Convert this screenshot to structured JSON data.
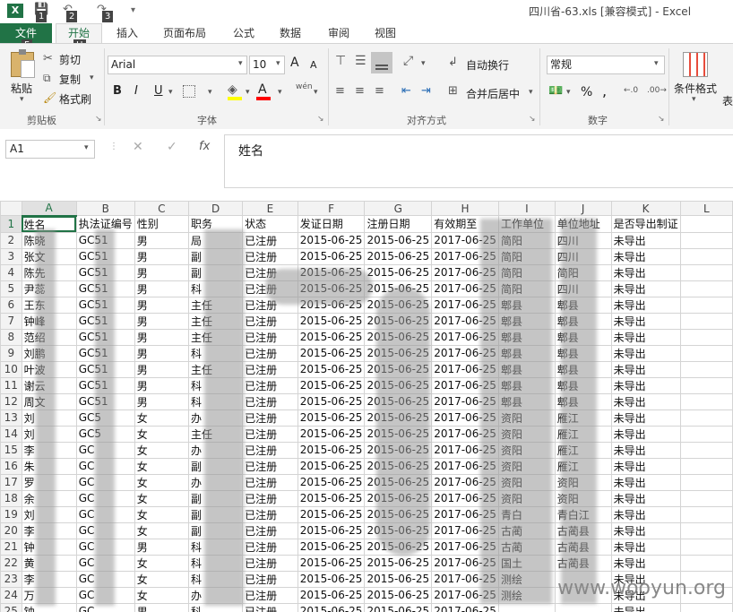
{
  "window": {
    "title": "四川省-63.xls  [兼容模式] - Excel",
    "keytips": [
      "1",
      "2",
      "3",
      "F",
      "H"
    ]
  },
  "tabs": {
    "file": "文件",
    "home": "开始",
    "insert": "插入",
    "layout": "页面布局",
    "formulas": "公式",
    "data": "数据",
    "review": "审阅",
    "view": "视图"
  },
  "ribbon": {
    "clipboard": {
      "paste": "粘贴",
      "cut": "剪切",
      "copy": "复制",
      "format_painter": "格式刷",
      "label": "剪贴板"
    },
    "font": {
      "name": "Arial",
      "size": "10",
      "bold": "B",
      "italic": "I",
      "underline": "U",
      "label": "字体",
      "grow": "A",
      "shrink": "A",
      "wen": "wén"
    },
    "alignment": {
      "wrap": "自动换行",
      "merge": "合并后居中",
      "label": "对齐方式"
    },
    "number": {
      "format": "常规",
      "percent": "%",
      "comma": ",",
      "label": "数字"
    },
    "styles": {
      "conditional": "条件格式",
      "table": "表"
    }
  },
  "formula_bar": {
    "name_box": "A1",
    "fx": "fx",
    "content": "姓名"
  },
  "sheet": {
    "columns": [
      "A",
      "B",
      "C",
      "D",
      "E",
      "F",
      "G",
      "H",
      "I",
      "J",
      "K",
      "L"
    ],
    "rows": [
      [
        "姓名",
        "执法证编号",
        "性别",
        "职务",
        "状态",
        "发证日期",
        "注册日期",
        "有效期至",
        "工作单位",
        "单位地址",
        "是否导出制证",
        ""
      ],
      [
        "陈晓",
        "GC51",
        "男",
        "局",
        "已注册",
        "2015-06-25",
        "2015-06-25",
        "2017-06-25",
        "简阳",
        "四川",
        "未导出",
        ""
      ],
      [
        "张文",
        "GC51",
        "男",
        "副",
        "已注册",
        "2015-06-25",
        "2015-06-25",
        "2017-06-25",
        "简阳",
        "四川",
        "未导出",
        ""
      ],
      [
        "陈先",
        "GC51",
        "男",
        "副",
        "已注册",
        "2015-06-25",
        "2015-06-25",
        "2017-06-25",
        "简阳",
        "简阳",
        "未导出",
        ""
      ],
      [
        "尹蕊",
        "GC51",
        "男",
        "科",
        "已注册",
        "2015-06-25",
        "2015-06-25",
        "2017-06-25",
        "简阳",
        "四川",
        "未导出",
        ""
      ],
      [
        "王东",
        "GC51",
        "男",
        "主任",
        "已注册",
        "2015-06-25",
        "2015-06-25",
        "2017-06-25",
        "郫县",
        "郫县",
        "未导出",
        ""
      ],
      [
        "钟峰",
        "GC51",
        "男",
        "主任",
        "已注册",
        "2015-06-25",
        "2015-06-25",
        "2017-06-25",
        "郫县",
        "郫县",
        "未导出",
        ""
      ],
      [
        "范绍",
        "GC51",
        "男",
        "主任",
        "已注册",
        "2015-06-25",
        "2015-06-25",
        "2017-06-25",
        "郫县",
        "郫县",
        "未导出",
        ""
      ],
      [
        "刘鹏",
        "GC51",
        "男",
        "科",
        "已注册",
        "2015-06-25",
        "2015-06-25",
        "2017-06-25",
        "郫县",
        "郫县",
        "未导出",
        ""
      ],
      [
        "叶波",
        "GC51",
        "男",
        "主任",
        "已注册",
        "2015-06-25",
        "2015-06-25",
        "2017-06-25",
        "郫县",
        "郫县",
        "未导出",
        ""
      ],
      [
        "谢云",
        "GC51",
        "男",
        "科",
        "已注册",
        "2015-06-25",
        "2015-06-25",
        "2017-06-25",
        "郫县",
        "郫县",
        "未导出",
        ""
      ],
      [
        "周文",
        "GC51",
        "男",
        "科",
        "已注册",
        "2015-06-25",
        "2015-06-25",
        "2017-06-25",
        "郫县",
        "郫县",
        "未导出",
        ""
      ],
      [
        "刘",
        "GC5",
        "女",
        "办",
        "已注册",
        "2015-06-25",
        "2015-06-25",
        "2017-06-25",
        "资阳",
        "雁江",
        "未导出",
        ""
      ],
      [
        "刘",
        "GC5",
        "女",
        "主任",
        "已注册",
        "2015-06-25",
        "2015-06-25",
        "2017-06-25",
        "资阳",
        "雁江",
        "未导出",
        ""
      ],
      [
        "李",
        "GC",
        "女",
        "办",
        "已注册",
        "2015-06-25",
        "2015-06-25",
        "2017-06-25",
        "资阳",
        "雁江",
        "未导出",
        ""
      ],
      [
        "朱",
        "GC",
        "女",
        "副",
        "已注册",
        "2015-06-25",
        "2015-06-25",
        "2017-06-25",
        "资阳",
        "雁江",
        "未导出",
        ""
      ],
      [
        "罗",
        "GC",
        "女",
        "办",
        "已注册",
        "2015-06-25",
        "2015-06-25",
        "2017-06-25",
        "资阳",
        "资阳",
        "未导出",
        ""
      ],
      [
        "余",
        "GC",
        "女",
        "副",
        "已注册",
        "2015-06-25",
        "2015-06-25",
        "2017-06-25",
        "资阳",
        "资阳",
        "未导出",
        ""
      ],
      [
        "刘",
        "GC",
        "女",
        "副",
        "已注册",
        "2015-06-25",
        "2015-06-25",
        "2017-06-25",
        "青白",
        "青白江",
        "未导出",
        ""
      ],
      [
        "李",
        "GC",
        "女",
        "副",
        "已注册",
        "2015-06-25",
        "2015-06-25",
        "2017-06-25",
        "古蔺",
        "古蔺县",
        "未导出",
        ""
      ],
      [
        "钟",
        "GC",
        "男",
        "科",
        "已注册",
        "2015-06-25",
        "2015-06-25",
        "2017-06-25",
        "古蔺",
        "古蔺县",
        "未导出",
        ""
      ],
      [
        "黄",
        "GC",
        "女",
        "科",
        "已注册",
        "2015-06-25",
        "2015-06-25",
        "2017-06-25",
        "国土",
        "古蔺县",
        "未导出",
        ""
      ],
      [
        "李",
        "GC",
        "女",
        "科",
        "已注册",
        "2015-06-25",
        "2015-06-25",
        "2017-06-25",
        "测绘",
        "",
        "未导出",
        ""
      ],
      [
        "万",
        "GC",
        "女",
        "办",
        "已注册",
        "2015-06-25",
        "2015-06-25",
        "2017-06-25",
        "测绘",
        "",
        "未导出",
        ""
      ],
      [
        "钟",
        "GC",
        "男",
        "科",
        "已注册",
        "2015-06-25",
        "2015-06-25",
        "2017-06-25",
        "",
        "",
        "未导出",
        ""
      ],
      [
        "夏",
        "GC",
        "男",
        "副",
        "已注册",
        "2015-06-25",
        "2015-06-25",
        "2017-06-25",
        "",
        "乐山",
        "未导出",
        ""
      ]
    ]
  },
  "watermark": "www.wooyun.org"
}
